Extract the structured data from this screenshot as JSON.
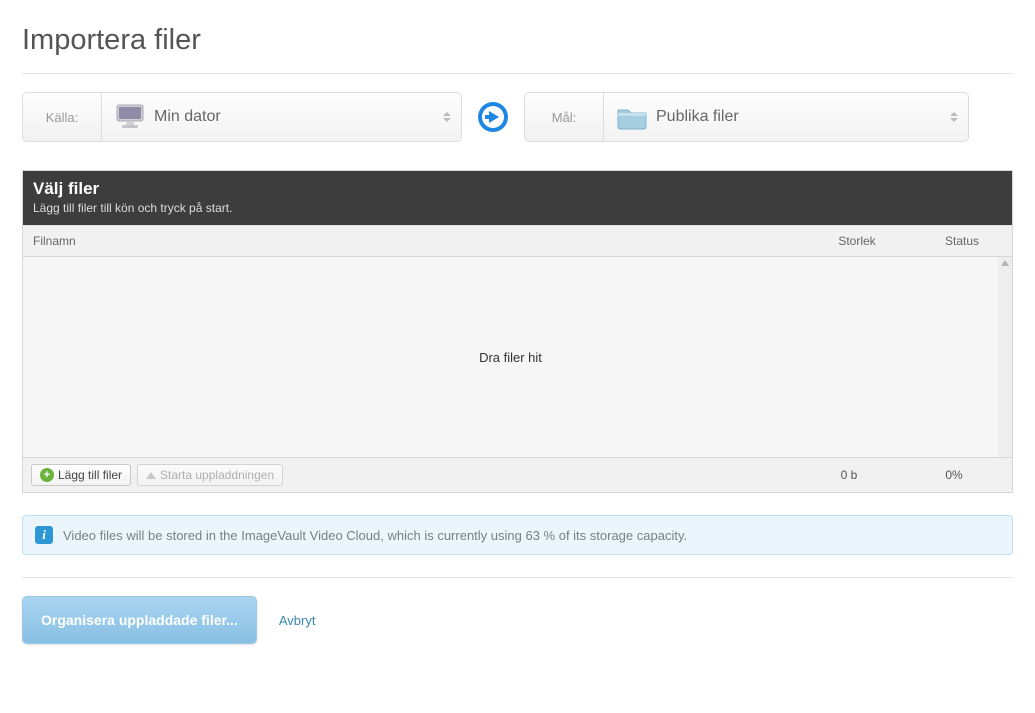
{
  "title": "Importera filer",
  "source": {
    "label": "Källa:",
    "value": "Min dator"
  },
  "dest": {
    "label": "Mål:",
    "value": "Publika filer"
  },
  "uploader": {
    "title": "Välj filer",
    "subtitle": "Lägg till filer till kön och tryck på start.",
    "columns": {
      "name": "Filnamn",
      "size": "Storlek",
      "status": "Status"
    },
    "drop_hint": "Dra filer hit",
    "add_label": "Lägg till filer",
    "start_label": "Starta uppladdningen",
    "total_size": "0 b",
    "percent": "0%"
  },
  "info_message": "Video files will be stored in the ImageVault Video Cloud, which is currently using 63 % of its storage capacity.",
  "actions": {
    "organize": "Organisera uppladdade filer...",
    "cancel": "Avbryt"
  }
}
